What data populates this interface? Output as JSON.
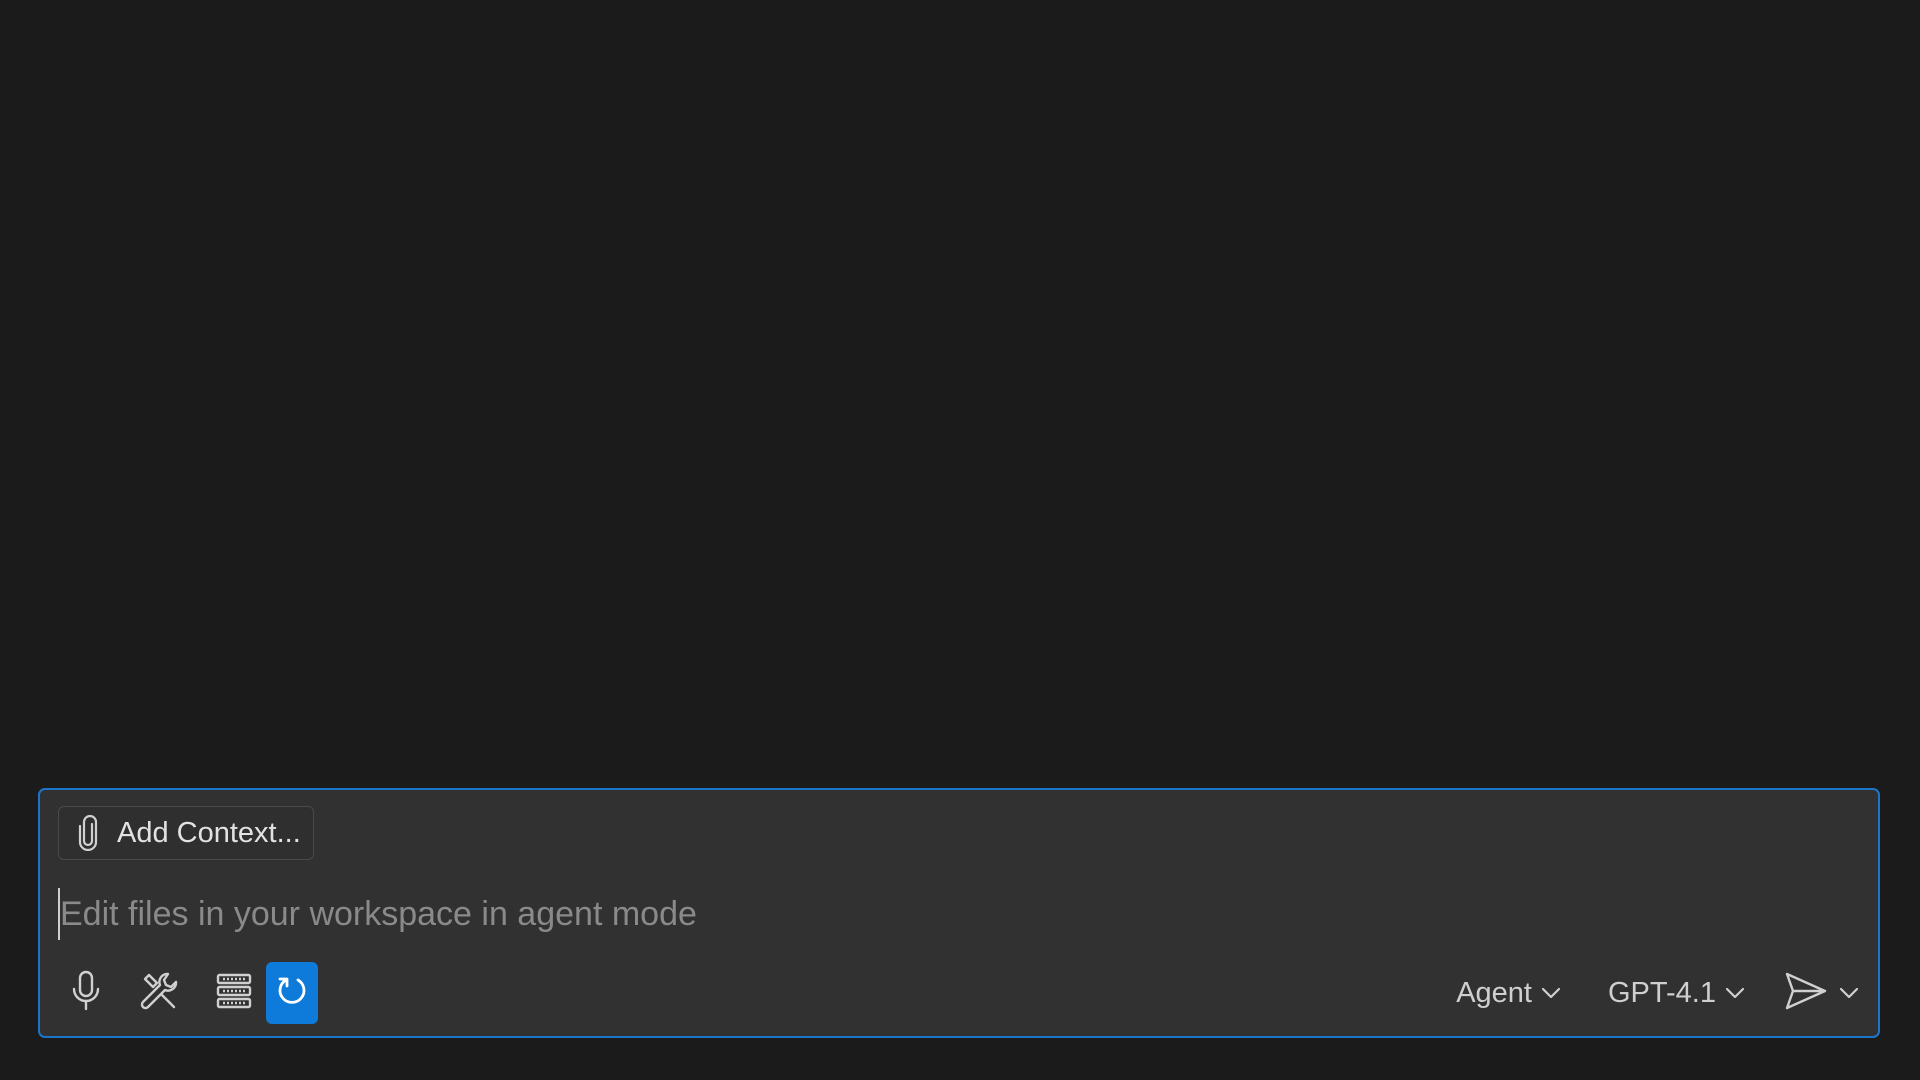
{
  "chat": {
    "add_context_label": "Add Context...",
    "prompt_placeholder": "Edit files in your workspace in agent mode",
    "mode_label": "Agent",
    "model_label": "GPT-4.1"
  },
  "icons": {
    "attach": "paperclip-icon",
    "voice": "microphone-icon",
    "tools": "tools-icon",
    "server": "server-icon",
    "refresh": "refresh-icon",
    "send": "send-icon",
    "chevron": "chevron-down-icon"
  },
  "colors": {
    "background": "#1b1b1b",
    "panel": "#313131",
    "panel_border": "#1d75c9",
    "active_button": "#0e7ad9"
  }
}
